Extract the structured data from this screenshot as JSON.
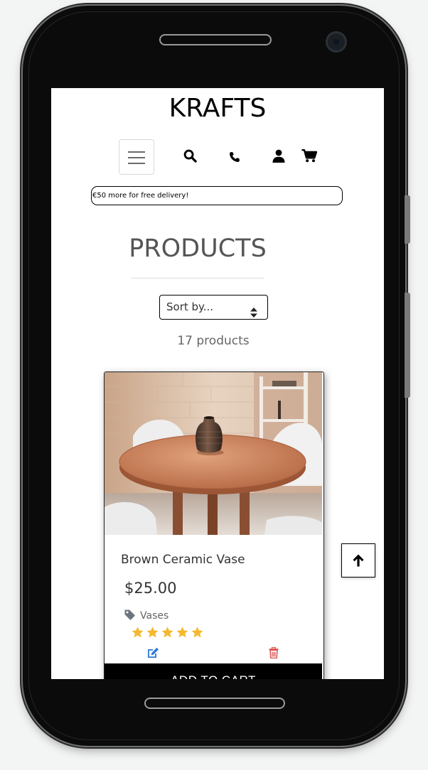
{
  "header": {
    "brand": "KRAFTS"
  },
  "nav": {
    "menu_icon": "hamburger-icon",
    "search_icon": "search-icon",
    "phone_icon": "phone-icon",
    "account_icon": "user-icon",
    "cart_icon": "cart-icon"
  },
  "banner": {
    "delivery_text": "€50 more for free delivery!"
  },
  "main": {
    "title": "PRODUCTS",
    "sort_placeholder": "Sort by...",
    "product_count": "17 products"
  },
  "products": [
    {
      "name": "Brown Ceramic Vase",
      "price": "$25.00",
      "category": "Vases",
      "rating": 5,
      "add_to_cart_label": "ADD TO CART"
    }
  ],
  "colors": {
    "star": "#f5b82e",
    "edit": "#2e7bd6",
    "delete": "#d9534f",
    "button_bg": "#000000"
  }
}
